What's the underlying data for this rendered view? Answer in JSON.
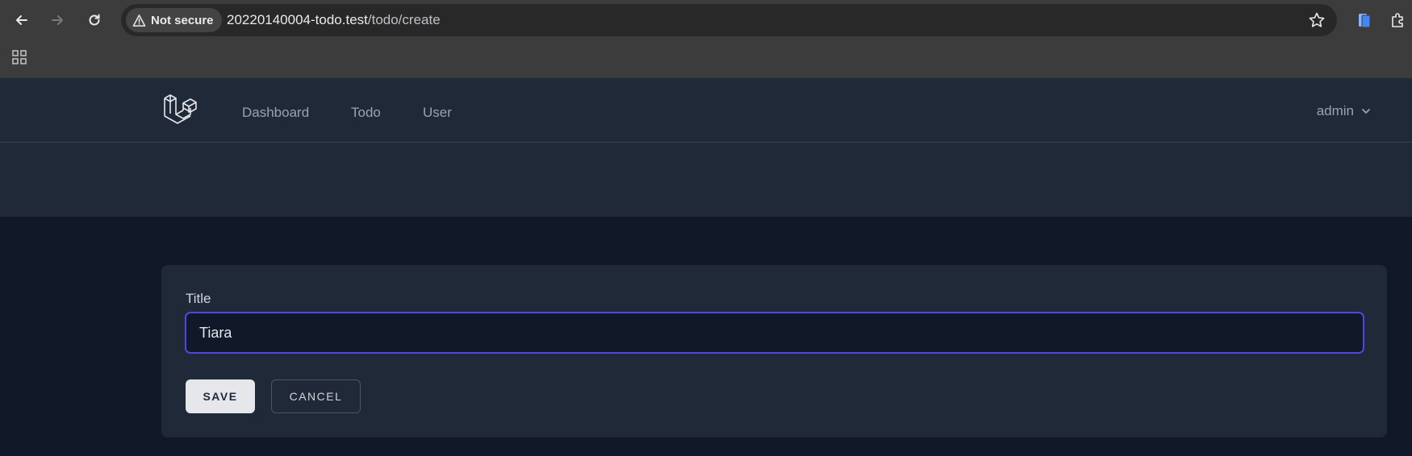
{
  "browser": {
    "security_label": "Not secure",
    "url_host": "20220140004-todo.test",
    "url_path": "/todo/create"
  },
  "nav": {
    "links": [
      "Dashboard",
      "Todo",
      "User"
    ],
    "user_name": "admin"
  },
  "form": {
    "title_label": "Title",
    "title_value": "Tiara",
    "save_label": "SAVE",
    "cancel_label": "CANCEL"
  },
  "colors": {
    "page_bg": "#111827",
    "panel_bg": "#1f2937",
    "focus_ring": "#4f46e5",
    "chrome_bg": "#3c3c3c"
  },
  "icons": {
    "back": "arrow-left-icon",
    "forward": "arrow-right-icon",
    "reload": "reload-icon",
    "security": "warning-triangle-icon",
    "bookmark": "star-icon",
    "apps": "grid-icon",
    "logo": "laravel-logo",
    "dropdown": "chevron-down-icon"
  }
}
